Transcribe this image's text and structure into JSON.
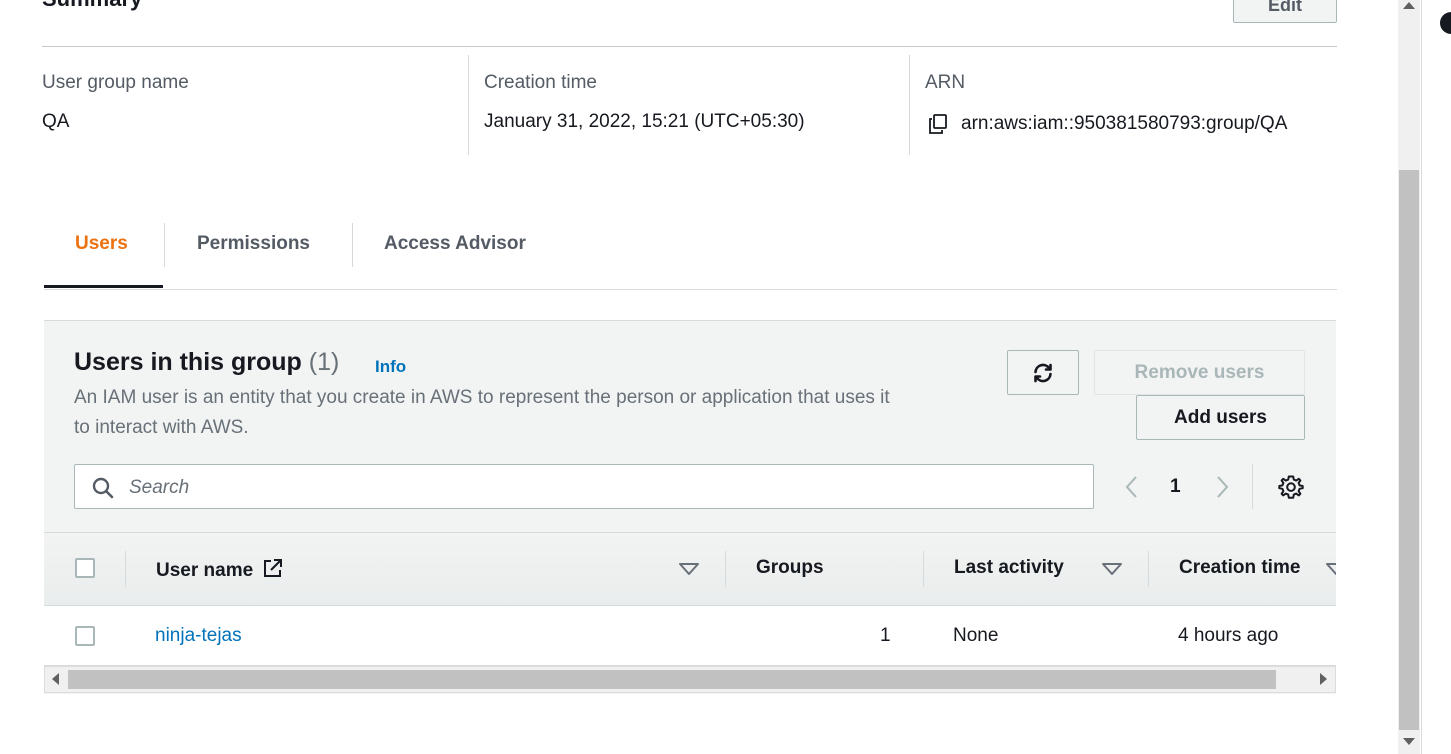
{
  "summary": {
    "title": "Summary",
    "edit_label": "Edit",
    "fields": [
      {
        "label": "User group name",
        "value": "QA"
      },
      {
        "label": "Creation time",
        "value": "January 31, 2022, 15:21 (UTC+05:30)"
      },
      {
        "label": "ARN",
        "value": "arn:aws:iam::950381580793:group/QA"
      }
    ]
  },
  "tabs": [
    {
      "label": "Users",
      "active": true
    },
    {
      "label": "Permissions",
      "active": false
    },
    {
      "label": "Access Advisor",
      "active": false
    }
  ],
  "users_panel": {
    "title": "Users in this group",
    "count": "(1)",
    "info_label": "Info",
    "description": "An IAM user is an entity that you create in AWS to represent the person or application that uses it to interact with AWS.",
    "remove_label": "Remove users",
    "add_label": "Add users",
    "search_placeholder": "Search",
    "page": "1"
  },
  "table": {
    "columns": [
      "User name",
      "Groups",
      "Last activity",
      "Creation time"
    ],
    "rows": [
      {
        "user_name": "ninja-tejas",
        "groups": "1",
        "last_activity": "None",
        "creation_time": "4 hours ago"
      }
    ]
  },
  "icons": {
    "copy": "copy-icon",
    "refresh": "refresh-icon",
    "search": "search-icon",
    "external_link": "external-link-icon",
    "settings": "gear-icon",
    "sort": "sort-down-icon"
  },
  "colors": {
    "accent": "#ec7211",
    "link": "#0073bb",
    "text": "#16191f",
    "muted": "#687078"
  }
}
